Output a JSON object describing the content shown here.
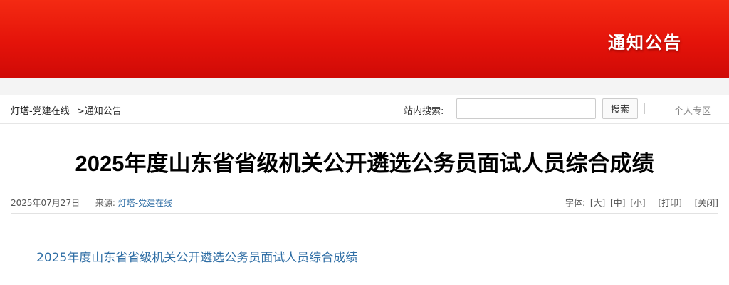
{
  "banner": {
    "title": "通知公告"
  },
  "breadcrumb": {
    "home": "灯塔-党建在线",
    "separator": ">",
    "current": "通知公告"
  },
  "search": {
    "label": "站内搜索:",
    "value": "",
    "button": "搜索"
  },
  "personal": {
    "label": "个人专区"
  },
  "article": {
    "title": "2025年度山东省省级机关公开遴选公务员面试人员综合成绩",
    "date": "2025年07月27日",
    "source_label": "来源:",
    "source_name": "灯塔-党建在线",
    "font_label": "字体:",
    "font_large": "[大]",
    "font_medium": "[中]",
    "font_small": "[小]",
    "print": "[打印]",
    "close": "[关闭]",
    "content_link": "2025年度山东省省级机关公开遴选公务员面试人员综合成绩"
  },
  "colors": {
    "banner_red": "#e4130a",
    "link_blue": "#2f6ea5"
  }
}
